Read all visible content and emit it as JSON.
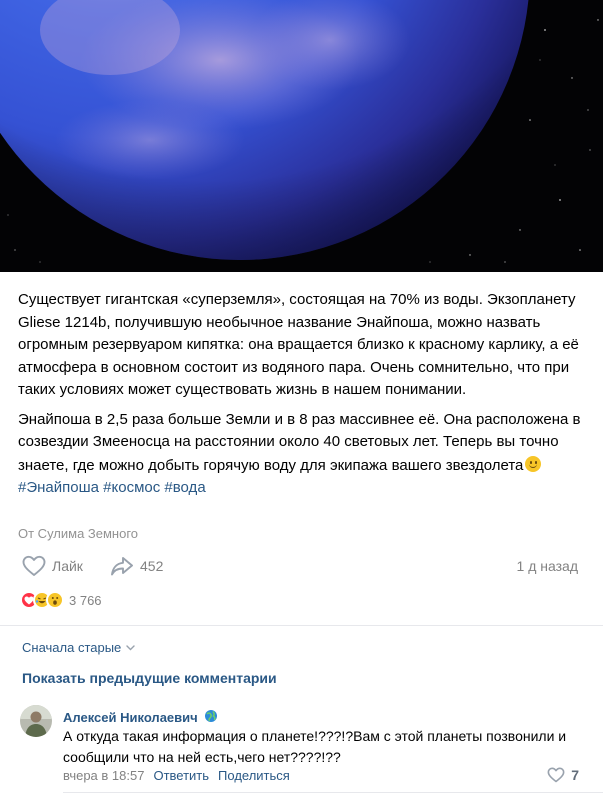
{
  "post": {
    "image_desc_icon": "exoplanet-image",
    "paragraphs": [
      "Существует гигантская «суперземля», состоящая на 70% из воды. Экзопланету Gliese 1214b, получившую необычное название Энайпоша, можно назвать огромным резервуаром кипятка: она вращается близко к красному карлику, а её атмосфера в основном состоит из водяного пара. Очень сомнительно, что при таких условиях может существовать жизнь в нашем понимании.",
      "Энайпоша в 2,5 раза больше Земли и в 8 раз массивнее её. Она расположена в созвездии Змееносца на расстоянии около 40 световых лет. Теперь вы точно знаете, где можно добыть горячую воду для экипажа вашего звездолета"
    ],
    "tags": [
      "#Энайпоша",
      "#космос",
      "#вода"
    ],
    "source": "От Сулима Земного",
    "like_label": "Лайк",
    "shares": "452",
    "time": "1 д назад",
    "reactions_count": "3 766"
  },
  "comments": {
    "sort_label": "Сначала старые",
    "show_prev_label": "Показать предыдущие комментарии",
    "items": [
      {
        "author": "Алексей Николаевич",
        "text": "А откуда такая информация о планете!???!?Вам с этой планеты позвонили и сообщили что на ней есть,чего нет????!??",
        "time": "вчера в 18:57",
        "reply_label": "Ответить",
        "share_label": "Поделиться",
        "likes": "7"
      }
    ]
  },
  "colors": {
    "link": "#2a5885",
    "muted": "#828282",
    "divider": "#e7e8ec"
  }
}
